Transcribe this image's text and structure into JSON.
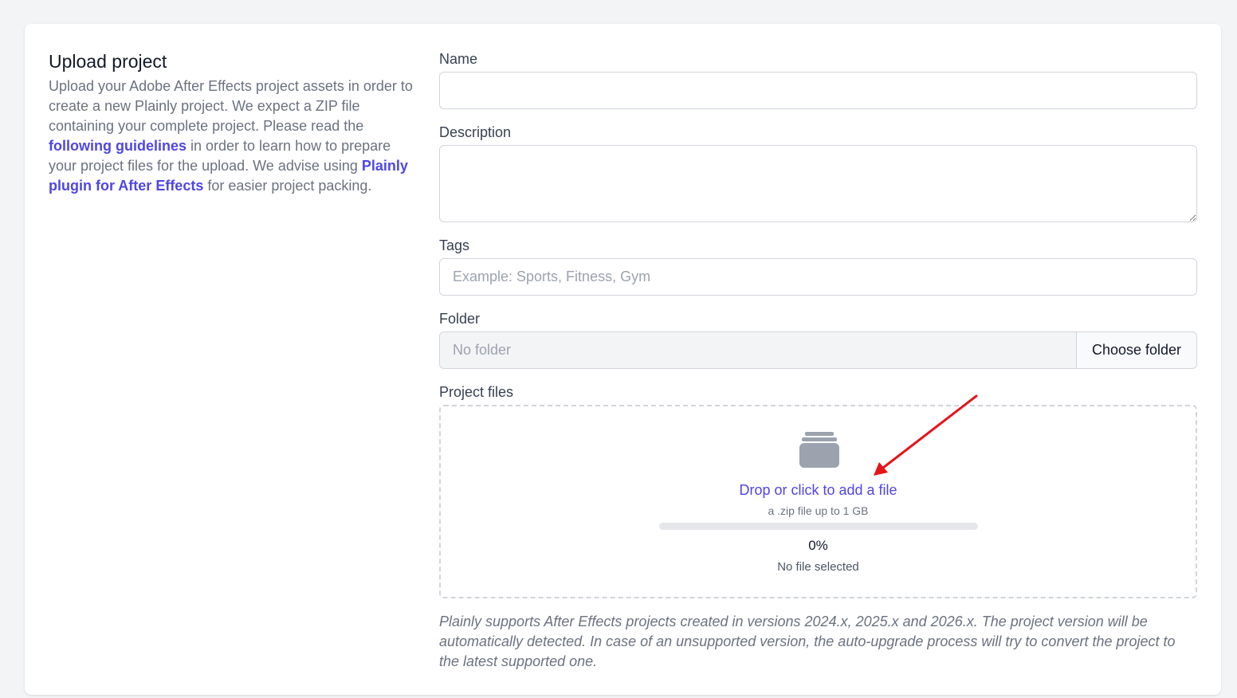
{
  "intro": {
    "title": "Upload project",
    "text_1": "Upload your Adobe After Effects project assets in order to create a new Plainly project. We expect a ZIP file containing your complete project. Please read the ",
    "link_guidelines": "following guidelines",
    "text_2": " in order to learn how to prepare your project files for the upload. We advise using ",
    "link_plugin": "Plainly plugin for After Effects",
    "text_3": " for easier project packing."
  },
  "form": {
    "name_label": "Name",
    "name_value": "",
    "description_label": "Description",
    "description_value": "",
    "tags_label": "Tags",
    "tags_placeholder": "Example: Sports, Fitness, Gym",
    "folder_label": "Folder",
    "folder_value": "No folder",
    "choose_folder_label": "Choose folder",
    "project_files_label": "Project files"
  },
  "dropzone": {
    "title": "Drop or click to add a file",
    "subtitle": "a .zip file up to 1 GB",
    "progress_percent": 0,
    "progress_label": "0%",
    "status": "No file selected",
    "icon": "archive-icon"
  },
  "note": "Plainly supports After Effects projects created in versions 2024.x, 2025.x and 2026.x. The project version will be automatically detected. In case of an unsupported version, the auto-upgrade process will try to convert the project to the latest supported one.",
  "colors": {
    "accent": "#4f46e5",
    "annotation_arrow": "#e3161c",
    "background": "#f3f4f6"
  }
}
